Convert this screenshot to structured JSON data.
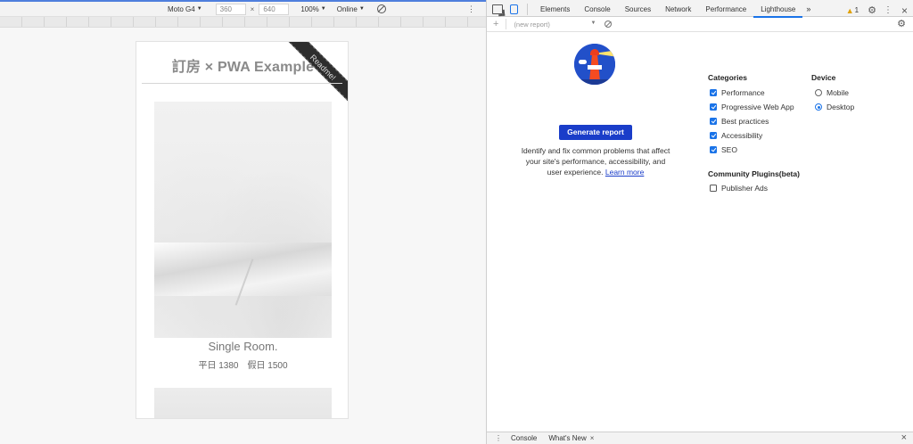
{
  "device_toolbar": {
    "device": "Moto G4",
    "width": "360",
    "times": "×",
    "height": "640",
    "zoom": "100%",
    "network": "Online"
  },
  "site": {
    "title": "訂房 × PWA Example",
    "ribbon": "Readme!",
    "rooms": [
      {
        "name": "Single Room.",
        "price": "平日 1380　假日 1500"
      }
    ]
  },
  "devtools": {
    "tabs": [
      "Elements",
      "Console",
      "Sources",
      "Network",
      "Performance",
      "Lighthouse"
    ],
    "active_tab": "Lighthouse",
    "more": "»",
    "warnings_count": "1",
    "report_select_placeholder": "(new report)",
    "lighthouse": {
      "generate_label": "Generate report",
      "description": "Identify and fix common problems that affect your site's performance, accessibility, and user experience.",
      "learn_more": "Learn more",
      "categories_title": "Categories",
      "categories": [
        {
          "label": "Performance",
          "checked": true
        },
        {
          "label": "Progressive Web App",
          "checked": true
        },
        {
          "label": "Best practices",
          "checked": true
        },
        {
          "label": "Accessibility",
          "checked": true
        },
        {
          "label": "SEO",
          "checked": true
        }
      ],
      "device_title": "Device",
      "devices": [
        {
          "label": "Mobile",
          "selected": false
        },
        {
          "label": "Desktop",
          "selected": true
        }
      ],
      "plugins_title": "Community Plugins(beta)",
      "plugins": [
        {
          "label": "Publisher Ads",
          "checked": false
        }
      ]
    },
    "drawer": {
      "tabs": [
        "Console",
        "What's New"
      ],
      "close_tab": "×"
    }
  },
  "colors": {
    "accent": "#1a73e8",
    "generate_button": "#1a3dc9"
  }
}
